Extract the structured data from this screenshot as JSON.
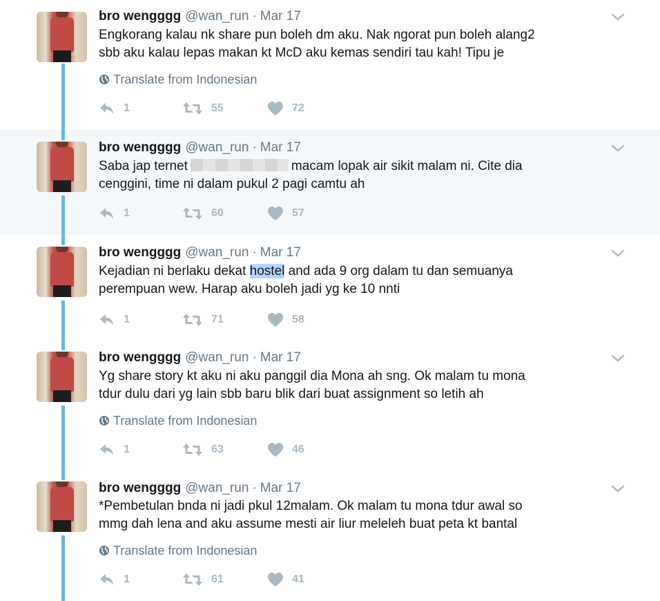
{
  "tweets": [
    {
      "name": "bro wengggg",
      "handle": "@wan_run",
      "dot": "·",
      "date": "Mar 17",
      "lines": [
        "Engkorang kalau nk share pun boleh dm aku. Nak ngorat pun boleh alang2",
        "sbb aku kalau lepas makan kt McD aku kemas sendiri tau kah! Tipu je"
      ],
      "translate": "Translate from Indonesian",
      "replies": "1",
      "retweets": "55",
      "likes": "72"
    },
    {
      "name": "bro wengggg",
      "handle": "@wan_run",
      "dot": "·",
      "date": "Mar 17",
      "line1_before": "Saba jap ternet",
      "line1_after": "macam lopak air sikit malam ni. Cite dia",
      "line2": "cenggini, time ni dalam pukul 2 pagi camtu ah",
      "replies": "1",
      "retweets": "60",
      "likes": "57"
    },
    {
      "name": "bro wengggg",
      "handle": "@wan_run",
      "dot": "·",
      "date": "Mar 17",
      "line1_before": "Kejadian ni berlaku dekat ",
      "line1_selected": "hostel",
      "line1_after": " and ada 9 org dalam tu dan semuanya",
      "line2": "perempuan wew. Harap aku boleh jadi yg ke 10 nnti",
      "replies": "1",
      "retweets": "71",
      "likes": "58"
    },
    {
      "name": "bro wengggg",
      "handle": "@wan_run",
      "dot": "·",
      "date": "Mar 17",
      "lines": [
        "Yg share story kt aku ni aku panggil dia Mona ah sng. Ok malam tu mona",
        "tdur dulu dari yg lain sbb baru blik dari buat assignment so letih ah"
      ],
      "translate": "Translate from Indonesian",
      "replies": "1",
      "retweets": "63",
      "likes": "46"
    },
    {
      "name": "bro wengggg",
      "handle": "@wan_run",
      "dot": "·",
      "date": "Mar 17",
      "lines": [
        "*Pembetulan bnda ni jadi pkul 12malam. Ok malam tu mona tdur awal so",
        "mmg dah lena and aku assume mesti air liur meleleh buat peta kt bantal"
      ],
      "translate": "Translate from Indonesian",
      "replies": "1",
      "retweets": "61",
      "likes": "41"
    }
  ],
  "colors": {
    "thread_line": "#6bb5dc",
    "highlight_bg": "#f5f8fa",
    "muted": "#657786",
    "action_icon": "#aab8c2",
    "selection": "#b4d5fe"
  },
  "icons": [
    "globe-icon",
    "reply-icon",
    "retweet-icon",
    "heart-icon",
    "chevron-down-icon"
  ]
}
